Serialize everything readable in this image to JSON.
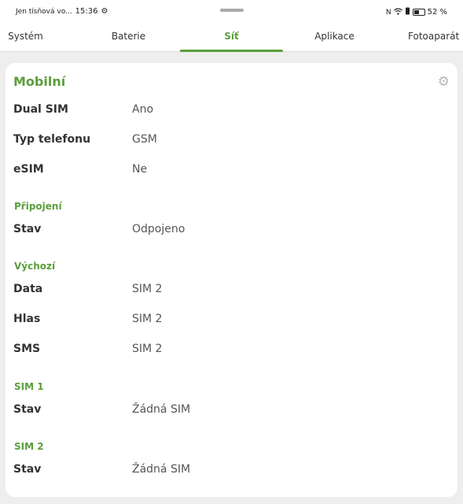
{
  "status_bar": {
    "carrier": "Jen tísňová vo...",
    "time": "15:36",
    "battery_percent": "52 %",
    "battery_level": 0.52,
    "icons": [
      "settings-gear-icon",
      "nfc-icon",
      "wifi-icon",
      "vibrate-icon",
      "battery-icon"
    ]
  },
  "tabs": [
    {
      "label": "Systém",
      "active": false
    },
    {
      "label": "Baterie",
      "active": false
    },
    {
      "label": "Síť",
      "active": true
    },
    {
      "label": "Aplikace",
      "active": false
    },
    {
      "label": "Fotoaparát",
      "active": false
    }
  ],
  "card": {
    "title": "Mobilní",
    "settings_icon": "gear-icon",
    "rows": [
      {
        "label": "Dual SIM",
        "value": "Ano"
      },
      {
        "label": "Typ telefonu",
        "value": "GSM"
      },
      {
        "label": "eSIM",
        "value": "Ne"
      }
    ],
    "sections": [
      {
        "title": "Připojení",
        "rows": [
          {
            "label": "Stav",
            "value": "Odpojeno"
          }
        ]
      },
      {
        "title": "Výchozí",
        "rows": [
          {
            "label": "Data",
            "value": "SIM 2"
          },
          {
            "label": "Hlas",
            "value": "SIM 2"
          },
          {
            "label": "SMS",
            "value": "SIM 2"
          }
        ]
      },
      {
        "title": "SIM 1",
        "rows": [
          {
            "label": "Stav",
            "value": "Žádná SIM"
          }
        ]
      },
      {
        "title": "SIM 2",
        "rows": [
          {
            "label": "Stav",
            "value": "Žádná SIM"
          }
        ]
      }
    ]
  },
  "colors": {
    "accent": "#5a9e3b",
    "background": "#eeeeee",
    "card": "#ffffff"
  }
}
